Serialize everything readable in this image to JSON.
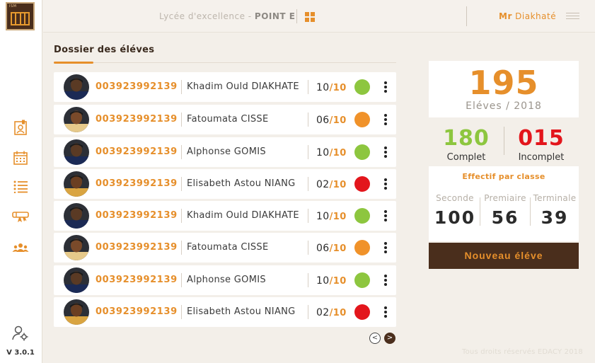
{
  "logo": {
    "text": "ISM",
    "icon": "building-icon"
  },
  "sidebar": {
    "items": [
      {
        "name": "student-file-icon"
      },
      {
        "name": "calendar-icon"
      },
      {
        "name": "list-icon"
      },
      {
        "name": "graduation-icon"
      },
      {
        "name": "users-icon"
      }
    ],
    "settings_icon": "user-settings-icon",
    "version": "V 3.0.1"
  },
  "header": {
    "school_prefix": "Lycée d'excellence - ",
    "school_name": "POINT E",
    "grid_icon": "grid-icon",
    "user_prefix": "Mr",
    "user_name": " Diakhaté",
    "menu_icon": "hamburger-icon"
  },
  "section": {
    "title": "Dossier des éléves"
  },
  "students": [
    {
      "matricule": "003923992139",
      "name": "Khadim Ould DIAKHATE",
      "score": "10",
      "den": "/10",
      "status": "#8dc63f",
      "skin": "#5a3a24",
      "clothes": "#1b2a55"
    },
    {
      "matricule": "003923992139",
      "name": "Fatoumata CISSE",
      "score": "06",
      "den": "/10",
      "status": "#f0922a",
      "skin": "#7a4a2a",
      "clothes": "#e6c98a"
    },
    {
      "matricule": "003923992139",
      "name": "Alphonse GOMIS",
      "score": "10",
      "den": "/10",
      "status": "#8dc63f",
      "skin": "#5a3a24",
      "clothes": "#1b2a55"
    },
    {
      "matricule": "003923992139",
      "name": "Elisabeth Astou NIANG",
      "score": "02",
      "den": "/10",
      "status": "#e3161c",
      "skin": "#6b3f22",
      "clothes": "#d9a441"
    },
    {
      "matricule": "003923992139",
      "name": "Khadim Ould DIAKHATE",
      "score": "10",
      "den": "/10",
      "status": "#8dc63f",
      "skin": "#5a3a24",
      "clothes": "#1b2a55"
    },
    {
      "matricule": "003923992139",
      "name": "Fatoumata CISSE",
      "score": "06",
      "den": "/10",
      "status": "#f0922a",
      "skin": "#7a4a2a",
      "clothes": "#e6c98a"
    },
    {
      "matricule": "003923992139",
      "name": "Alphonse GOMIS",
      "score": "10",
      "den": "/10",
      "status": "#8dc63f",
      "skin": "#5a3a24",
      "clothes": "#1b2a55"
    },
    {
      "matricule": "003923992139",
      "name": "Elisabeth Astou NIANG",
      "score": "02",
      "den": "/10",
      "status": "#e3161c",
      "skin": "#6b3f22",
      "clothes": "#d9a441"
    }
  ],
  "pagination": {
    "prev": "<",
    "next": ">"
  },
  "stats": {
    "total": "195",
    "total_label": "Eléves / 2018",
    "complete": "180",
    "complete_label": "Complet",
    "complete_color": "#8dc63f",
    "incomplete": "015",
    "incomplete_label": "Incomplet",
    "incomplete_color": "#e3161c"
  },
  "by_class": {
    "title": "Effectif par classe",
    "columns": [
      {
        "label": "Seconde",
        "value": "100"
      },
      {
        "label": "Premiaire",
        "value": "56"
      },
      {
        "label": "Terminale",
        "value": "39"
      }
    ]
  },
  "new_button": "Nouveau éléve",
  "footer": "Tous droits réservés EDACY 2018",
  "colors": {
    "accent": "#e68f2b",
    "brown": "#4a2e1c",
    "background": "#f3efe9"
  }
}
